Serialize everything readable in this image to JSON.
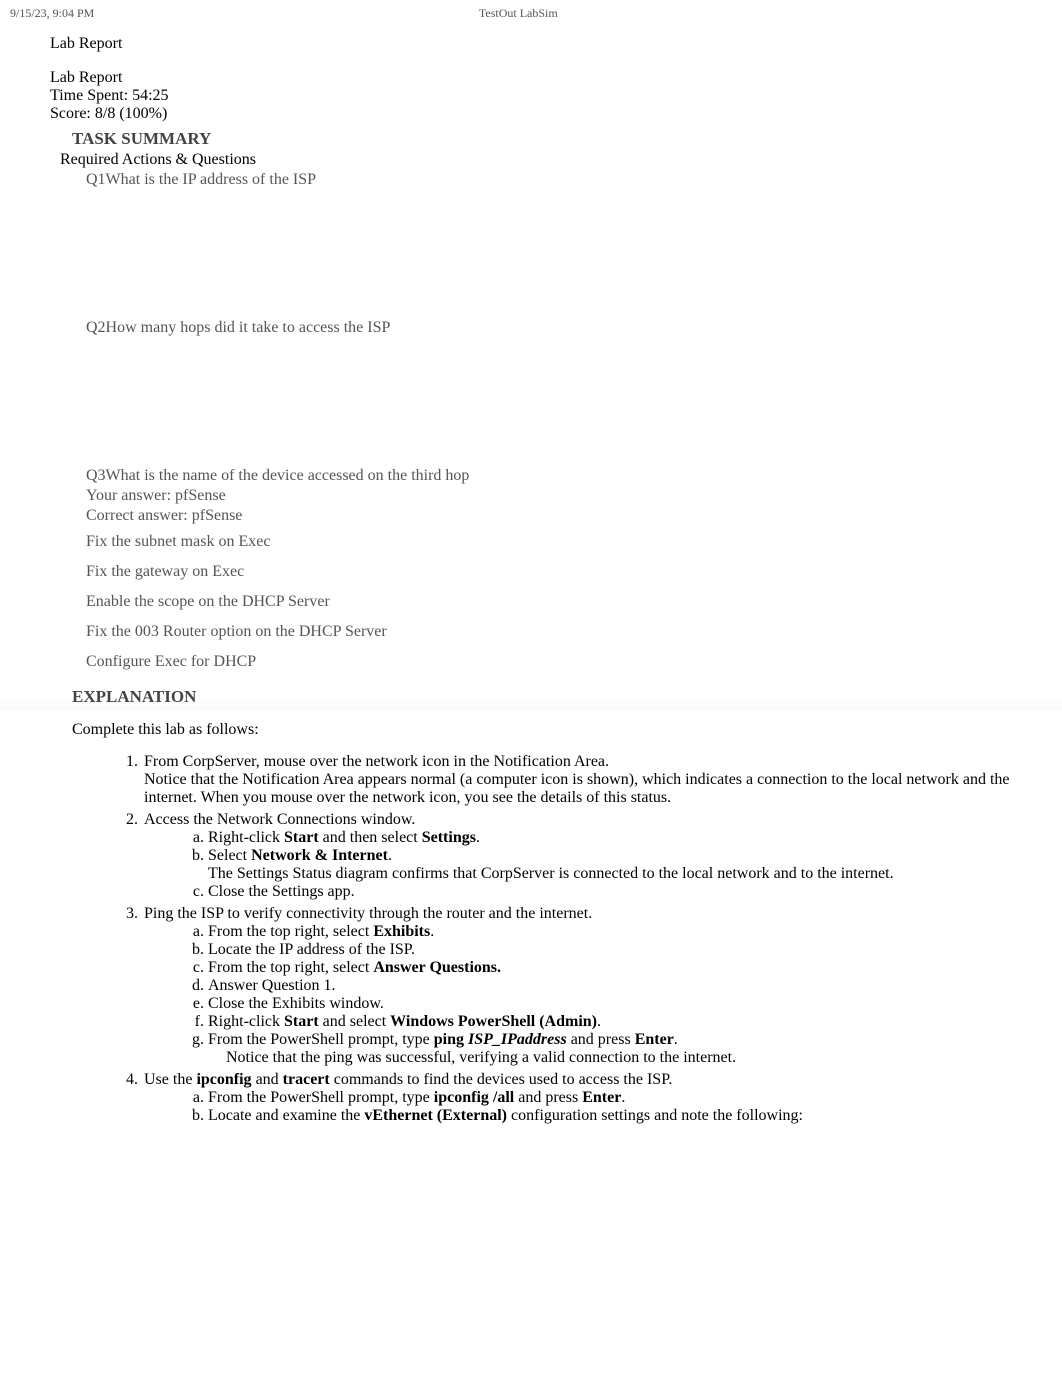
{
  "header": {
    "timestamp": "9/15/23, 9:04 PM",
    "app_title": "TestOut LabSim"
  },
  "report": {
    "title": "Lab Report",
    "subtitle": "Lab Report",
    "time_spent_label": "Time Spent: ",
    "time_spent_value": "54:25",
    "score_label": "Score: ",
    "score_value": "8/8 (100%)",
    "task_summary_heading": "TASK SUMMARY",
    "required_heading": "Required Actions & Questions",
    "explanation_heading": "EXPLANATION",
    "intro": "Complete this lab as follows:"
  },
  "questions": {
    "q1": "Q1What is the IP address of the ISP",
    "q2": "Q2How many hops did it take to access the ISP",
    "q3": "Q3What is the name of the device accessed on the third hop",
    "q3_your_answer_label": "Your answer: ",
    "q3_your_answer_value": "pfSense",
    "q3_correct_answer_label": "Correct answer: ",
    "q3_correct_answer_value": "pfSense"
  },
  "tasks": {
    "t1": "Fix the subnet mask on Exec",
    "t2": "Fix the gateway on Exec",
    "t3": "Enable the scope on the DHCP Server",
    "t4": "Fix the 003 Router option on the DHCP Server",
    "t5": "Configure Exec for DHCP"
  },
  "steps": {
    "s1_text": "From CorpServer, mouse over the network icon in the Notification Area.",
    "s1_note": "Notice that the Notification Area appears normal (a computer icon is shown), which indicates a connection to the local network and the internet. When you mouse over the network icon, you see the details of this status.",
    "s2_text": "Access the Network Connections window.",
    "s2a_pre": "Right-click ",
    "s2a_b1": "Start",
    "s2a_mid": " and then select ",
    "s2a_b2": "Settings",
    "s2a_post": ".",
    "s2b_pre": "Select ",
    "s2b_b1": "Network & Internet",
    "s2b_post": ".",
    "s2b_note": "The Settings Status diagram confirms that CorpServer is connected to the local network and to the internet.",
    "s2c": "Close the Settings app.",
    "s3_text": "Ping the ISP to verify connectivity through the router and the internet.",
    "s3a_pre": "From the top right, select ",
    "s3a_b1": "Exhibits",
    "s3a_post": ".",
    "s3b": "Locate the IP address of the ISP.",
    "s3c_pre": "From the top right, select ",
    "s3c_b1": "Answer Questions.",
    "s3d": "Answer Question 1.",
    "s3e": "Close the Exhibits window.",
    "s3f_pre": "Right-click ",
    "s3f_b1": "Start",
    "s3f_mid": " and select ",
    "s3f_b2": "Windows PowerShell (Admin)",
    "s3f_post": ".",
    "s3g_pre": "From the PowerShell prompt, type ",
    "s3g_b1": "ping ",
    "s3g_i1": "ISP_IPaddress",
    "s3g_mid": " and press ",
    "s3g_b2": "Enter",
    "s3g_post": ".",
    "s3g_note": "Notice that the ping was successful, verifying a valid connection to the internet.",
    "s4_pre": "Use the ",
    "s4_b1": "ipconfig",
    "s4_mid1": " and ",
    "s4_b2": "tracert",
    "s4_post": " commands to find the devices used to access the ISP.",
    "s4a_pre": "From the PowerShell prompt, type ",
    "s4a_b1": "ipconfig /all",
    "s4a_mid": " and press ",
    "s4a_b2": "Enter",
    "s4a_post": ".",
    "s4b_pre": "Locate and examine the ",
    "s4b_b1": "vEthernet (External)",
    "s4b_post": " configuration settings and note the following:"
  }
}
